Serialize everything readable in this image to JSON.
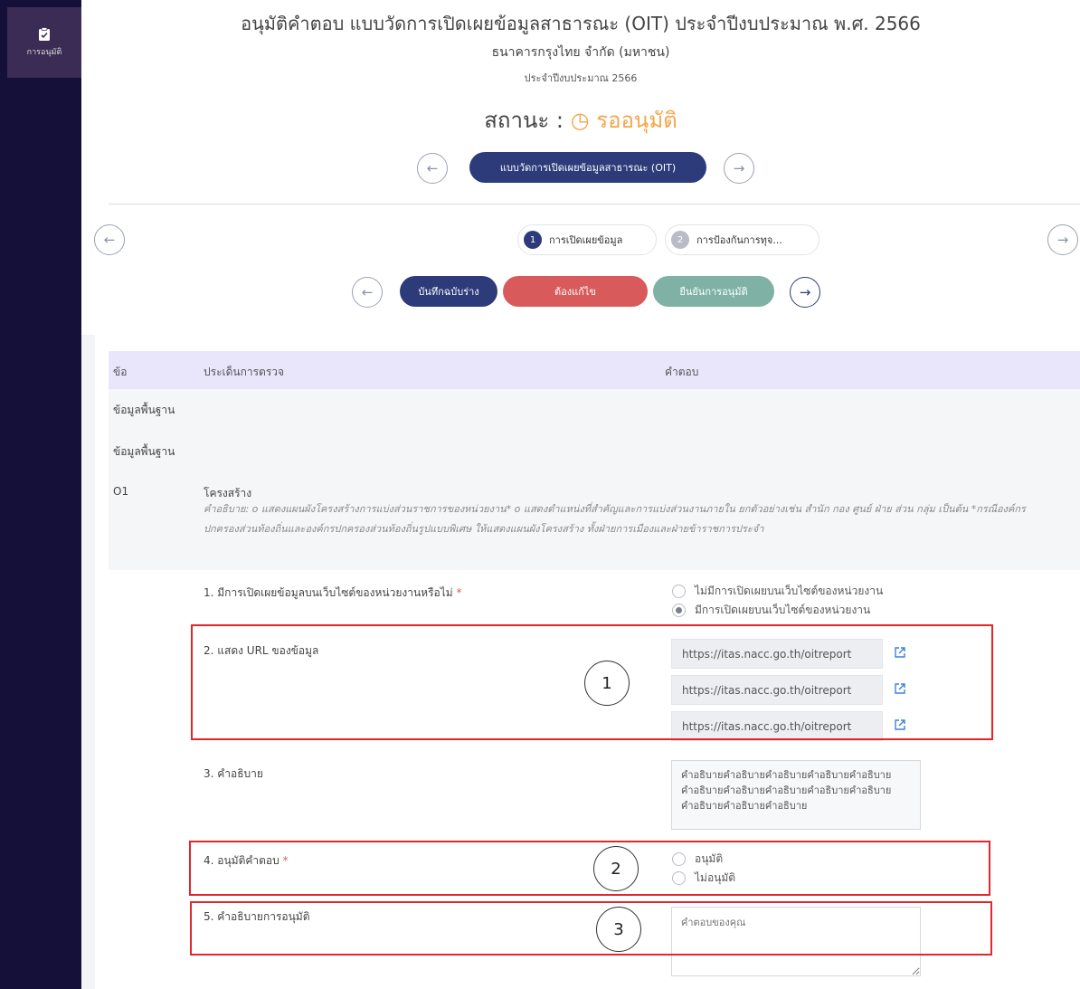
{
  "sidebar": {
    "item_label": "การอนุมัติ",
    "item_icon": "clipboard-check-icon"
  },
  "header": {
    "title": "อนุมัติคำตอบ แบบวัดการเปิดเผยข้อมูลสาธารณะ (OIT) ประจำปีงบประมาณ พ.ศ. 2566",
    "organization": "ธนาคารกรุงไทย จำกัด (มหาชน)",
    "fiscal_year": "ประจำปีงบประมาณ 2566",
    "status_label": "สถานะ :",
    "status_value": "รออนุมัติ",
    "form_pill": "แบบวัดการเปิดเผยข้อมูลสาธารณะ (OIT)"
  },
  "steps": [
    {
      "number": "1",
      "label": "การเปิดเผยข้อมูล"
    },
    {
      "number": "2",
      "label": "การป้องกันการทุจ..."
    }
  ],
  "actions": {
    "save_draft": "บันทึกฉบับร่าง",
    "needs_fix": "ต้องแก้ไข",
    "confirm": "ยืนยันการอนุมัติ"
  },
  "table": {
    "col_no": "ข้อ",
    "col_issue": "ประเด็นการตรวจ",
    "col_answer": "คำตอบ",
    "section1": "ข้อมูลพื้นฐาน",
    "section2": "ข้อมูลพื้นฐาน"
  },
  "item": {
    "code": "O1",
    "title": "โครงสร้าง",
    "description": "คำอธิบาย: o แสดงแผนผังโครงสร้างการแบ่งส่วนราชการของหน่วยงาน* o แสดงตำแหน่งที่สำคัญและการแบ่งส่วนงานภายใน ยกตัวอย่างเช่น สำนัก กอง ศูนย์ ฝ่าย ส่วน กลุ่ม เป็นต้น *กรณีองค์กรปกครองส่วนท้องถิ่นและองค์กรปกครองส่วนท้องถิ่นรูปแบบพิเศษ ให้แสดงแผนผังโครงสร้าง ทั้งฝ่ายการเมืองและฝ่ายข้าราชการประจำ"
  },
  "questions": {
    "q1": "1. มีการเปิดเผยข้อมูลบนเว็บไซต์ของหน่วยงานหรือไม่",
    "q1_opt1": "ไม่มีการเปิดเผยบนเว็บไซต์ของหน่วยงาน",
    "q1_opt2": "มีการเปิดเผยบนเว็บไซต์ของหน่วยงาน",
    "q2": "2. แสดง URL ของข้อมูล",
    "urls": [
      "https://itas.nacc.go.th/oitreport",
      "https://itas.nacc.go.th/oitreport",
      "https://itas.nacc.go.th/oitreport"
    ],
    "q3": "3. คำอธิบาย",
    "q3_text": "คำอธิบายคำอธิบายคำอธิบายคำอธิบายคำอธิบายคำอธิบายคำอธิบายคำอธิบายคำอธิบายคำอธิบายคำอธิบายคำอธิบายคำอธิบาย",
    "q4": "4. อนุมัติคำตอบ",
    "q4_opt1": "อนุมัติ",
    "q4_opt2": "ไม่อนุมัติ",
    "q5": "5. คำอธิบายการอนุมัติ",
    "q5_placeholder": "คำตอบของคุณ"
  },
  "required_mark": "*",
  "callouts": [
    "1",
    "2",
    "3"
  ],
  "colors": {
    "primary": "#2d3b7a",
    "danger": "#d95a5a",
    "confirm": "#7fb2a4",
    "pending": "#f5a64a",
    "highlight": "#e3262b"
  }
}
